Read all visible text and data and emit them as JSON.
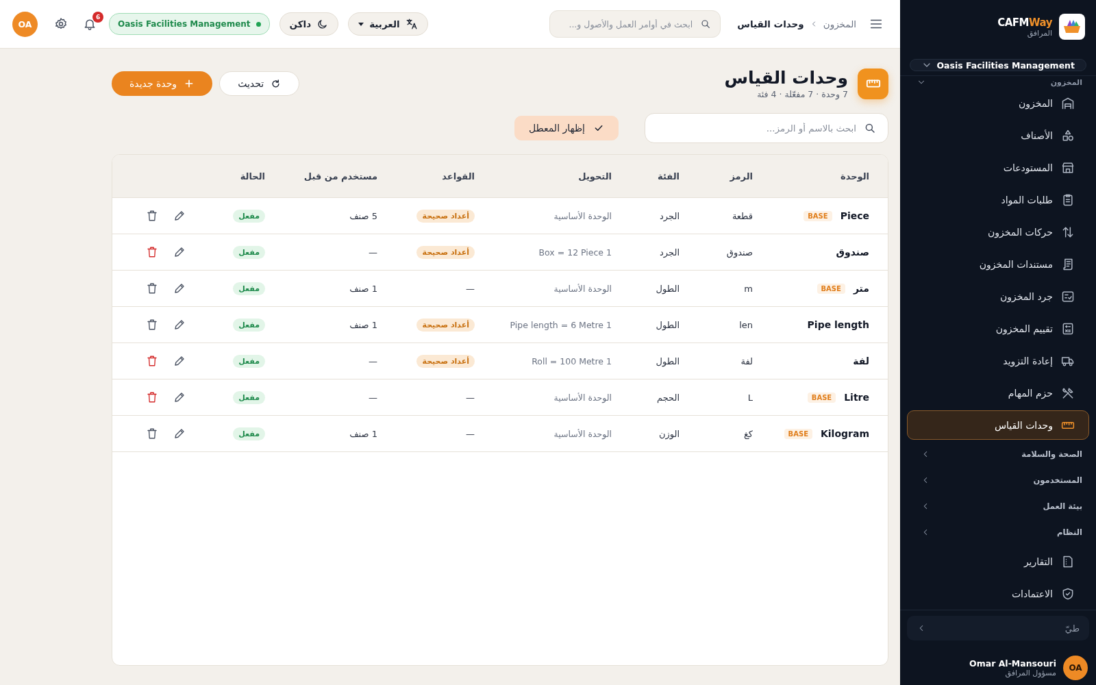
{
  "header": {
    "breadcrumb": [
      {
        "label": "المخزون",
        "current": false
      },
      {
        "label": "وحدات القياس",
        "current": true
      }
    ],
    "search": {
      "placeholder": "ابحث في أوامر العمل والأصول و..."
    },
    "language": "العربية",
    "theme": "داكن",
    "org": "Oasis Facilities Management",
    "notifications": "6",
    "avatar": "OA"
  },
  "sidebar": {
    "brand_main": "CAFM",
    "brand_accent": "Way",
    "brand_subtitle": "المرافق",
    "org_select": "Oasis Facilities Management",
    "section": {
      "label": "المخزون",
      "expanded": true
    },
    "items": [
      {
        "label": "المخزون",
        "selected": false
      },
      {
        "label": "الأصناف",
        "selected": false
      },
      {
        "label": "المستودعات",
        "selected": false
      },
      {
        "label": "طلبات المواد",
        "selected": false
      },
      {
        "label": "حركات المخزون",
        "selected": false
      },
      {
        "label": "مستندات المخزون",
        "selected": false
      },
      {
        "label": "جرد المخزون",
        "selected": false
      },
      {
        "label": "تقييم المخزون",
        "selected": false
      },
      {
        "label": "إعادة التزويد",
        "selected": false
      },
      {
        "label": "حزم المهام",
        "selected": false
      },
      {
        "label": "وحدات القياس",
        "selected": true
      }
    ],
    "groups": [
      {
        "label": "الصحة والسلامة",
        "expanded": false
      },
      {
        "label": "المستخدمون",
        "expanded": false
      },
      {
        "label": "بيئة العمل",
        "expanded": false
      },
      {
        "label": "النظام",
        "expanded": false
      }
    ],
    "links": [
      {
        "label": "التقارير"
      },
      {
        "label": "الاعتمادات"
      }
    ],
    "collapse": "طيّ",
    "user": {
      "name": "Omar Al-Mansouri",
      "role": "مسؤول المرافق",
      "initials": "OA"
    }
  },
  "page": {
    "title": "وحدات القياس",
    "subtitle": "7 وحدة · 7 مفعّلة · 4 فئة",
    "refresh": "تحديث",
    "new": "وحدة جديدة",
    "search": {
      "placeholder": "ابحث بالاسم أو الرمز..."
    },
    "toggle": {
      "label": "إظهار المعطل",
      "checked": true
    }
  },
  "table": {
    "columns": [
      "الوحدة",
      "الرمز",
      "الفئة",
      "التحويل",
      "القواعد",
      "مستخدم من قبل",
      "الحالة"
    ],
    "rows": [
      {
        "name": "Piece",
        "badge": "BASE",
        "code": "قطعة",
        "category": "الجرد",
        "conversion": "الوحدة الأساسية",
        "rules": {
          "kind": "badge",
          "text": "أعداد صحيحة"
        },
        "used_by": "5 صنف",
        "status": "مفعل",
        "enabled": true,
        "deletable": false
      },
      {
        "name": "صندوق",
        "code": "صندوق",
        "category": "الجرد",
        "conversion": "1 Box = 12 Piece",
        "rules": {
          "kind": "badge",
          "text": "أعداد صحيحة"
        },
        "used_by": "—",
        "status": "مفعل",
        "enabled": true,
        "deletable": true
      },
      {
        "name": "متر",
        "badge": "BASE",
        "code": "m",
        "category": "الطول",
        "conversion": "الوحدة الأساسية",
        "rules": {
          "kind": "plain",
          "text": "—"
        },
        "used_by": "1 صنف",
        "status": "مفعل",
        "enabled": true,
        "deletable": false
      },
      {
        "name": "Pipe length",
        "code": "len",
        "category": "الطول",
        "conversion": "1 Pipe length = 6 Metre",
        "rules": {
          "kind": "badge",
          "text": "أعداد صحيحة"
        },
        "used_by": "1 صنف",
        "status": "مفعل",
        "enabled": true,
        "deletable": false
      },
      {
        "name": "لفة",
        "code": "لفة",
        "category": "الطول",
        "conversion": "1 Roll = 100 Metre",
        "rules": {
          "kind": "badge",
          "text": "أعداد صحيحة"
        },
        "used_by": "—",
        "status": "مفعل",
        "enabled": true,
        "deletable": true
      },
      {
        "name": "Litre",
        "badge": "BASE",
        "code": "L",
        "category": "الحجم",
        "conversion": "الوحدة الأساسية",
        "rules": {
          "kind": "plain",
          "text": "—"
        },
        "used_by": "—",
        "status": "مفعل",
        "enabled": true,
        "deletable": true
      },
      {
        "name": "Kilogram",
        "badge": "BASE",
        "code": "كغ",
        "category": "الوزن",
        "conversion": "الوحدة الأساسية",
        "rules": {
          "kind": "plain",
          "text": "—"
        },
        "used_by": "1 صنف",
        "status": "مفعل",
        "enabled": true,
        "deletable": false
      }
    ]
  }
}
